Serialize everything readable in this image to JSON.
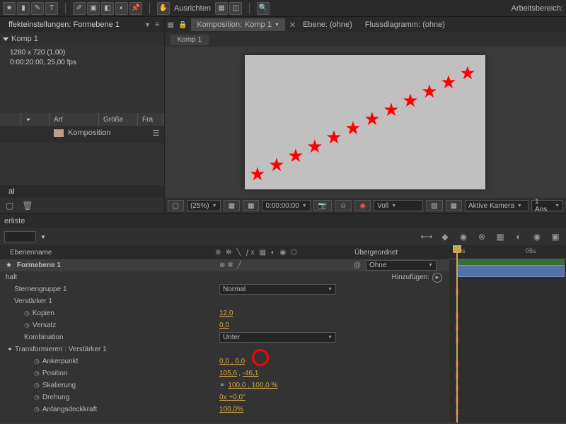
{
  "toolbar": {
    "align_label": "Ausrichten",
    "workspace_label": "Arbeitsbereich:"
  },
  "project": {
    "tab_label": "ffekteinstellungen: Formebene 1",
    "comp_name": "Komp 1",
    "dimensions": "1280 x 720 (1,00)",
    "duration_fps": "0:00:20:00, 25,00 fps",
    "cols": {
      "name": "",
      "label": "",
      "type": "Art",
      "size": "Größe",
      "fra": "Fra"
    },
    "item_type_label": "Komposition"
  },
  "composition": {
    "tab_prefix": "Komposition:",
    "tab_name": "Komp 1",
    "nil_layer": "Ebene: (ohne)",
    "nil_flow": "Flussdiagramm: (ohne)",
    "subtab": "Komp 1"
  },
  "viewer_controls": {
    "zoom": "(25%)",
    "timecode": "0:00:00:00",
    "channel": "Voll",
    "camera": "Aktive Kamera",
    "views": "1 Ans"
  },
  "timeline": {
    "tab": "erliste",
    "header_layername": "Ebenenname",
    "header_parent": "Übergeordnet",
    "add_label": "Hinzufügen:",
    "parent_none": "Ohne",
    "ruler": {
      "zero": "00s",
      "five": "05s"
    }
  },
  "layer": {
    "name": "Formebene 1",
    "contents": "halt",
    "group": "Sternengruppe 1",
    "mode_normal": "Normal",
    "repeater": "Verstärker 1",
    "copies_label": "Kopien",
    "copies_value": "12,0",
    "offset_label": "Versatz",
    "offset_value": "0,0",
    "combo_label": "Kombination",
    "combo_value": "Unter",
    "transform_label": "Transformieren : Verstärker 1",
    "anchor_label": "Ankerpunkt",
    "anchor_value": "0,0 , 0,0",
    "position_label": "Position",
    "position_x": "105,6",
    "position_y": "-46,1",
    "scale_label": "Skalierung",
    "scale_value": "100,0 , 100,0 %",
    "rotation_label": "Drehung",
    "rotation_value": "0x +0,0°",
    "opacity_label": "Anfangsdeckkraft",
    "opacity_value": "100,0%"
  }
}
